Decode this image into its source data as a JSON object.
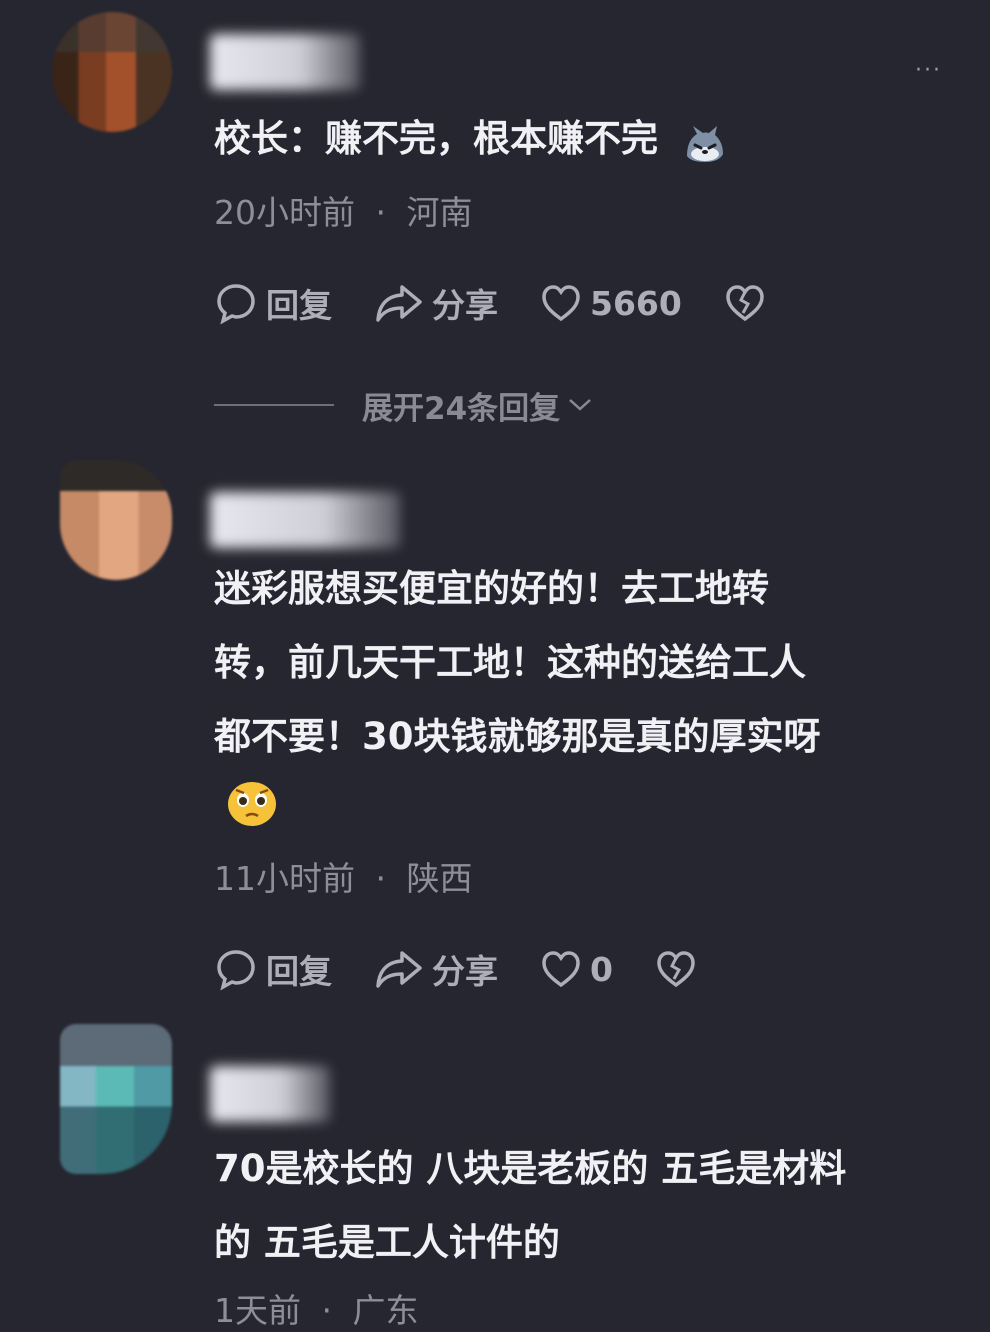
{
  "comments": [
    {
      "text": "校长：赚不完，根本赚不完",
      "time": "20小时前",
      "dot": "·",
      "location": "河南",
      "reply_label": "回复",
      "share_label": "分享",
      "likes": "5660",
      "more": "···",
      "expand_label": "展开24条回复",
      "emoji": "smirk-dog-emoji"
    },
    {
      "lines": [
        "迷彩服想买便宜的好的！去工地转",
        "转，前几天干工地！这种的送给工人",
        "都不要！30块钱就够那是真的厚实呀"
      ],
      "time": "11小时前",
      "dot": "·",
      "location": "陕西",
      "reply_label": "回复",
      "share_label": "分享",
      "likes": "0",
      "emoji": "pleading-face-emoji"
    },
    {
      "lines": [
        "70是校长的 八块是老板的 五毛是材料",
        "的 五毛是工人计件的"
      ],
      "time": "1天前",
      "dot": "·",
      "location": "广东"
    }
  ],
  "colors": {
    "background": "#262630",
    "text": "#f1f1f5",
    "meta": "#8e8e9a",
    "actions": "#aeaeb8"
  }
}
